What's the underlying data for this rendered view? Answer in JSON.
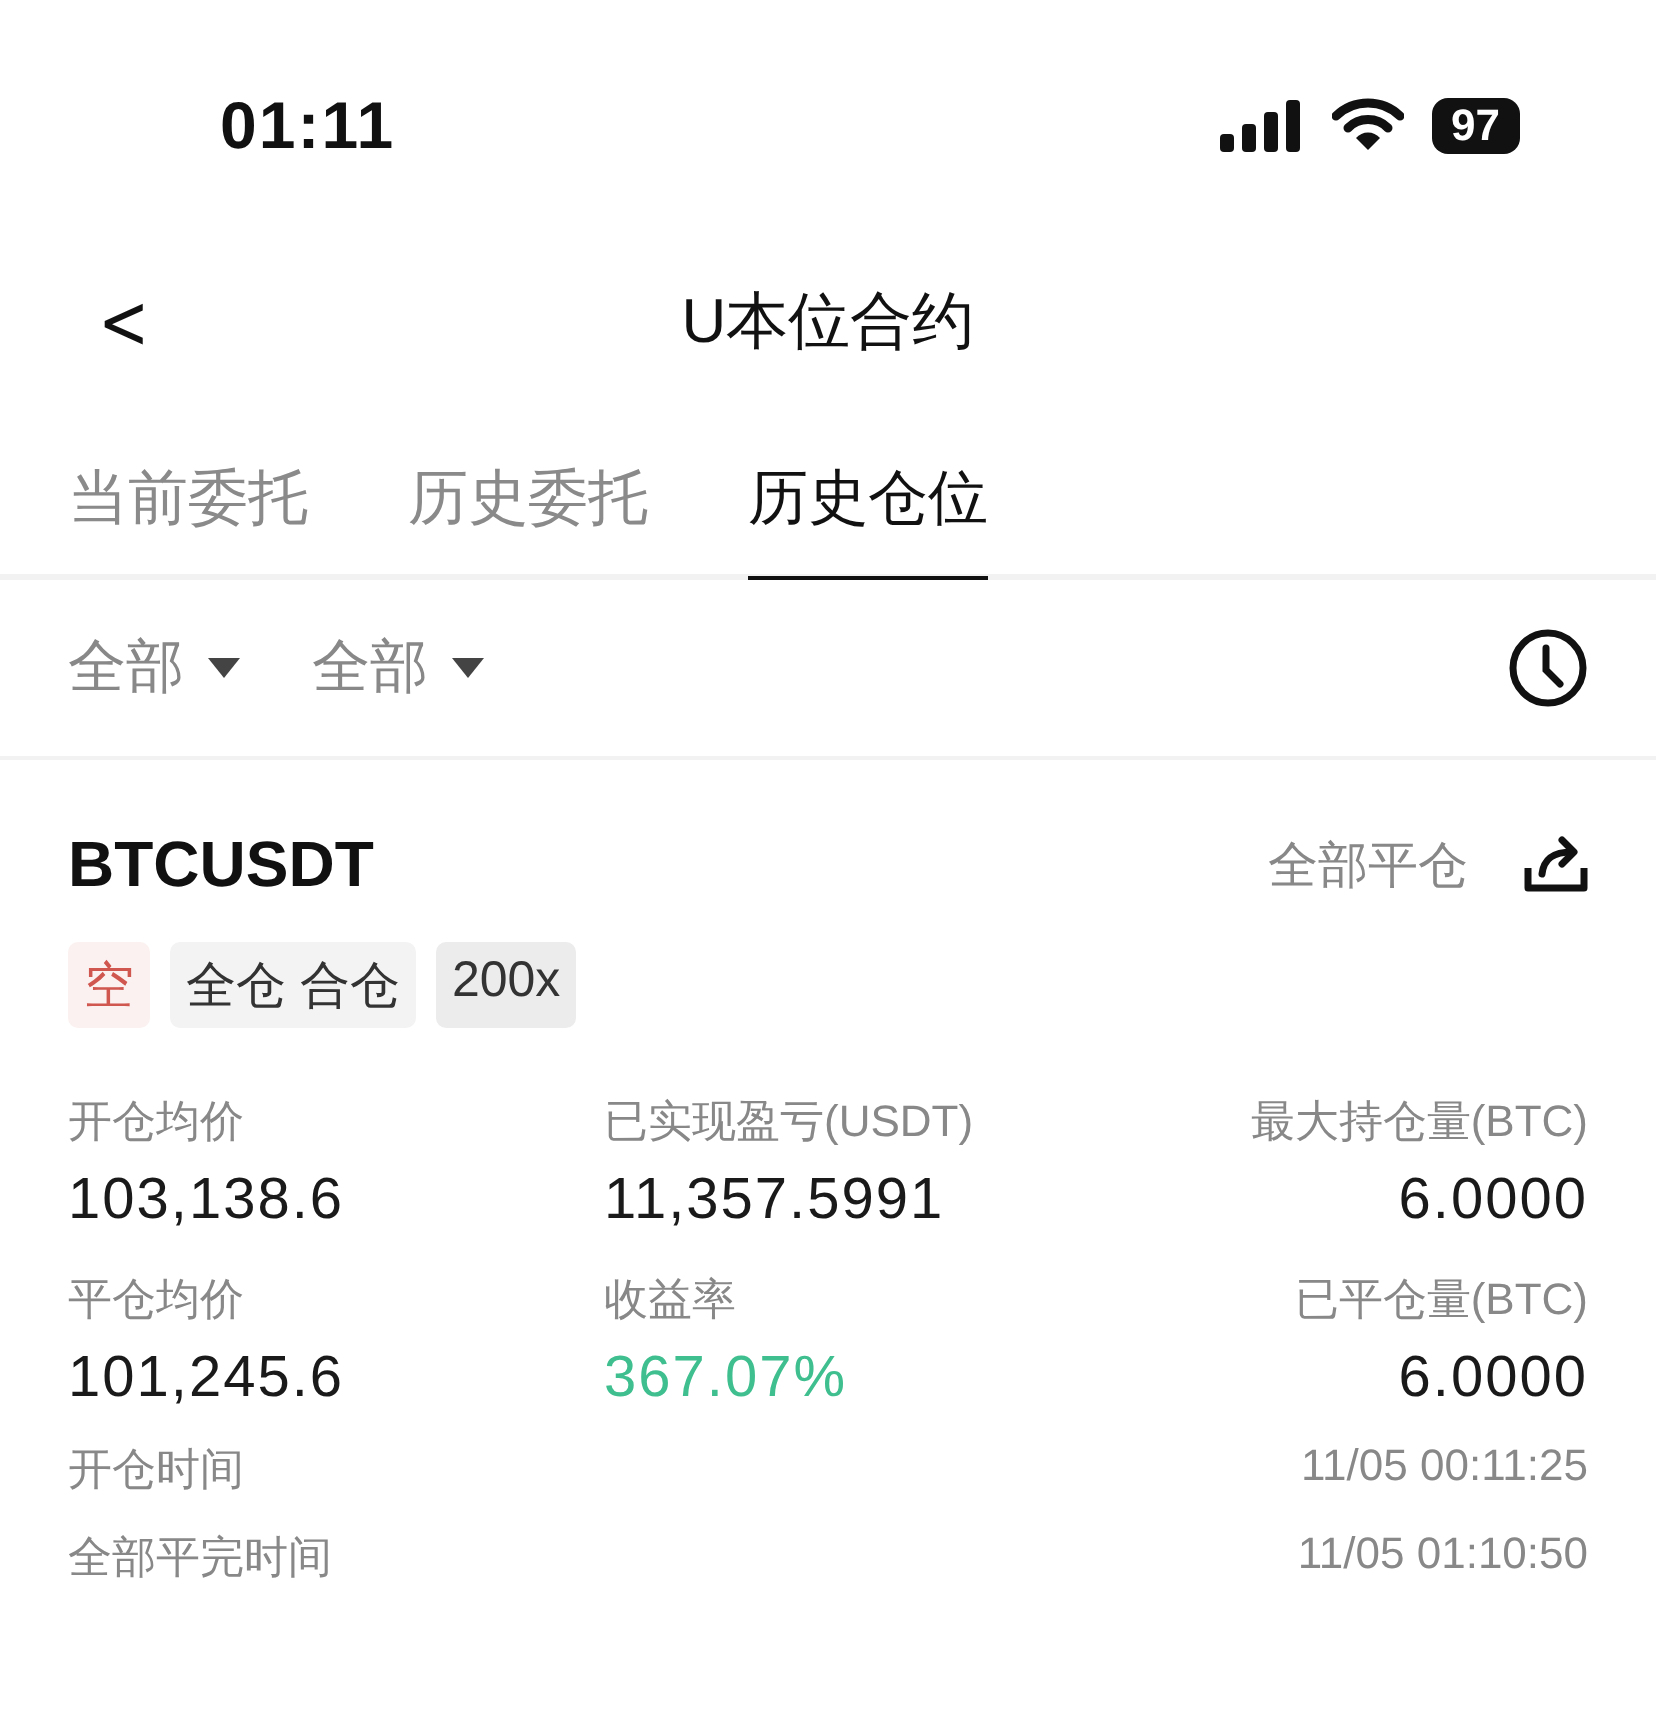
{
  "status_bar": {
    "time": "01:11",
    "battery": "97"
  },
  "header": {
    "back": "<",
    "title": "U本位合约"
  },
  "tabs": [
    {
      "label": "当前委托",
      "selected": false
    },
    {
      "label": "历史委托",
      "selected": false
    },
    {
      "label": "历史仓位",
      "selected": true
    }
  ],
  "filters": [
    {
      "label": "全部"
    },
    {
      "label": "全部"
    }
  ],
  "position": {
    "symbol": "BTCUSDT",
    "close_all": "全部平仓",
    "tags": [
      {
        "label": "空",
        "kind": "side"
      },
      {
        "label": "全仓 合仓",
        "kind": "plain"
      },
      {
        "label": "200x",
        "kind": "leverage"
      }
    ],
    "stats": [
      {
        "label": "开仓均价",
        "value": "103,138.6",
        "kind": "normal"
      },
      {
        "label": "已实现盈亏(USDT)",
        "value": "11,357.5991",
        "kind": "normal"
      },
      {
        "label": "最大持仓量(BTC)",
        "value": "6.0000",
        "kind": "normal"
      },
      {
        "label": "平仓均价",
        "value": "101,245.6",
        "kind": "normal"
      },
      {
        "label": "收益率",
        "value": "367.07%",
        "kind": "profit"
      },
      {
        "label": "已平仓量(BTC)",
        "value": "6.0000",
        "kind": "normal"
      }
    ],
    "times": [
      {
        "label": "开仓时间",
        "value": "11/05 00:11:25"
      },
      {
        "label": "全部平完时间",
        "value": "11/05 01:10:50"
      }
    ]
  }
}
